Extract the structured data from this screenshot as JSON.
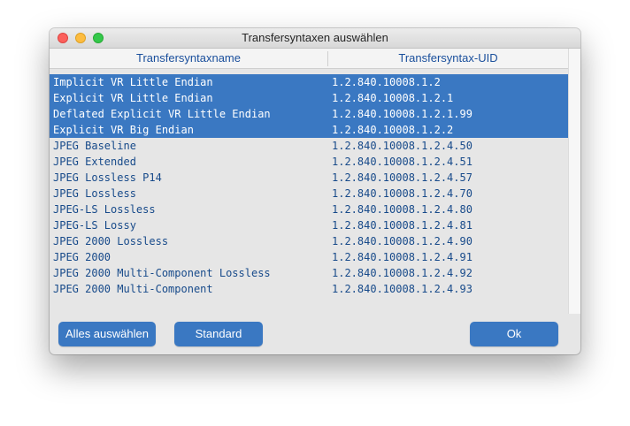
{
  "window": {
    "title": "Transfersyntaxen auswählen"
  },
  "table": {
    "columns": [
      "Transfersyntaxname",
      "Transfersyntax-UID"
    ],
    "rows": [
      {
        "name": "Implicit VR Little Endian",
        "uid": "1.2.840.10008.1.2",
        "selected": true
      },
      {
        "name": "Explicit VR Little Endian",
        "uid": "1.2.840.10008.1.2.1",
        "selected": true
      },
      {
        "name": "Deflated Explicit VR Little Endian",
        "uid": "1.2.840.10008.1.2.1.99",
        "selected": true
      },
      {
        "name": "Explicit VR Big Endian",
        "uid": "1.2.840.10008.1.2.2",
        "selected": true
      },
      {
        "name": "JPEG Baseline",
        "uid": "1.2.840.10008.1.2.4.50",
        "selected": false
      },
      {
        "name": "JPEG Extended",
        "uid": "1.2.840.10008.1.2.4.51",
        "selected": false
      },
      {
        "name": "JPEG Lossless P14",
        "uid": "1.2.840.10008.1.2.4.57",
        "selected": false
      },
      {
        "name": "JPEG Lossless",
        "uid": "1.2.840.10008.1.2.4.70",
        "selected": false
      },
      {
        "name": "JPEG-LS Lossless",
        "uid": "1.2.840.10008.1.2.4.80",
        "selected": false
      },
      {
        "name": "JPEG-LS Lossy",
        "uid": "1.2.840.10008.1.2.4.81",
        "selected": false
      },
      {
        "name": "JPEG 2000 Lossless",
        "uid": "1.2.840.10008.1.2.4.90",
        "selected": false
      },
      {
        "name": "JPEG 2000",
        "uid": "1.2.840.10008.1.2.4.91",
        "selected": false
      },
      {
        "name": "JPEG 2000 Multi-Component Lossless",
        "uid": "1.2.840.10008.1.2.4.92",
        "selected": false
      },
      {
        "name": "JPEG 2000 Multi-Component",
        "uid": "1.2.840.10008.1.2.4.93",
        "selected": false
      }
    ]
  },
  "buttons": {
    "select_all": "Alles auswählen",
    "standard": "Standard",
    "ok": "Ok"
  },
  "colors": {
    "selection": "#3a78c2",
    "text": "#174a8a",
    "header_text": "#1a4f9c",
    "button": "#3a78c2"
  }
}
